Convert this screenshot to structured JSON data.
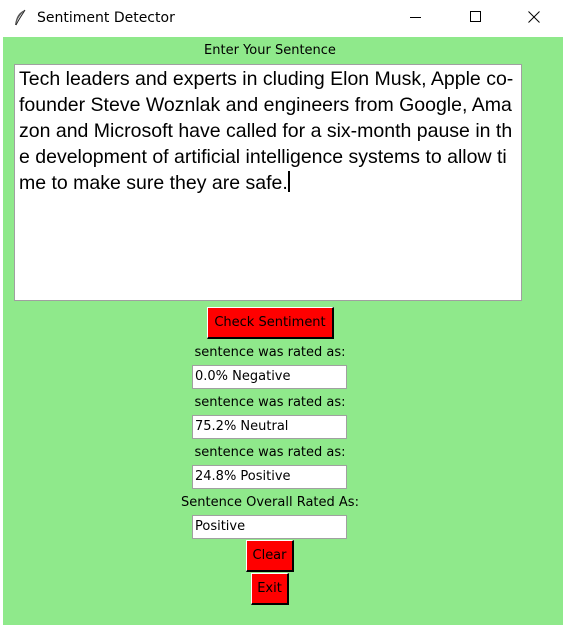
{
  "window": {
    "title": "Sentiment Detector"
  },
  "prompt_label": "Enter Your Sentence",
  "sentence_text": "Tech leaders and experts in cluding Elon Musk, Apple co-founder Steve Woznlak and engineers from Google, Amazon and Microsoft have called for a six-month pause in the development of artificial intelligence systems to allow time to make sure they are safe.",
  "check_button_label": "Check Sentiment",
  "results": [
    {
      "label": "sentence was rated as:",
      "value": "0.0% Negative"
    },
    {
      "label": "sentence was rated as:",
      "value": "75.2% Neutral"
    },
    {
      "label": "sentence was rated as:",
      "value": "24.8% Positive"
    },
    {
      "label": "Sentence Overall Rated As:",
      "value": "Positive"
    }
  ],
  "clear_button_label": "Clear",
  "exit_button_label": "Exit",
  "colors": {
    "background": "#8fe98b",
    "button": "#ff0000"
  }
}
